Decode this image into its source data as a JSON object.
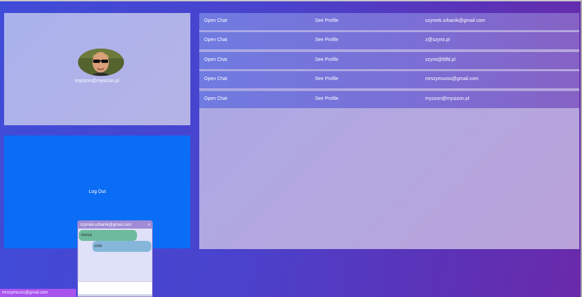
{
  "profile": {
    "email": "myszon@mysizon.pl"
  },
  "logout": {
    "label": "Log Out"
  },
  "users": [
    {
      "open_chat": "Open Chat",
      "see_profile": "See Profile",
      "email": "szymek.urbanik@gmail.com"
    },
    {
      "open_chat": "Open Chat",
      "see_profile": "See Profile",
      "email": "z@szymi.pl"
    },
    {
      "open_chat": "Open Chat",
      "see_profile": "See Profile",
      "email": "szymi@fdfd.pl"
    },
    {
      "open_chat": "Open Chat",
      "see_profile": "See Profile",
      "email": "mrszymusss@gmail.com"
    },
    {
      "open_chat": "Open Chat",
      "see_profile": "See Profile",
      "email": "myszon@mysizon.pl"
    }
  ],
  "chat": {
    "title": "szymek.urbanik@gmail.com",
    "close": "x",
    "messages": [
      {
        "text": "siema",
        "direction": "in"
      },
      {
        "text": "eldo",
        "direction": "out"
      }
    ],
    "input_value": ""
  },
  "current_user": {
    "email": "mrszymusss@gmail.com"
  },
  "colors": {
    "logout_bg": "#0b6cf5",
    "row_bg": "#7a6fd6",
    "current_user_bg": "#a853ee",
    "msg_in_bg": "#6dbb9c",
    "msg_out_bg": "#86b7db"
  }
}
